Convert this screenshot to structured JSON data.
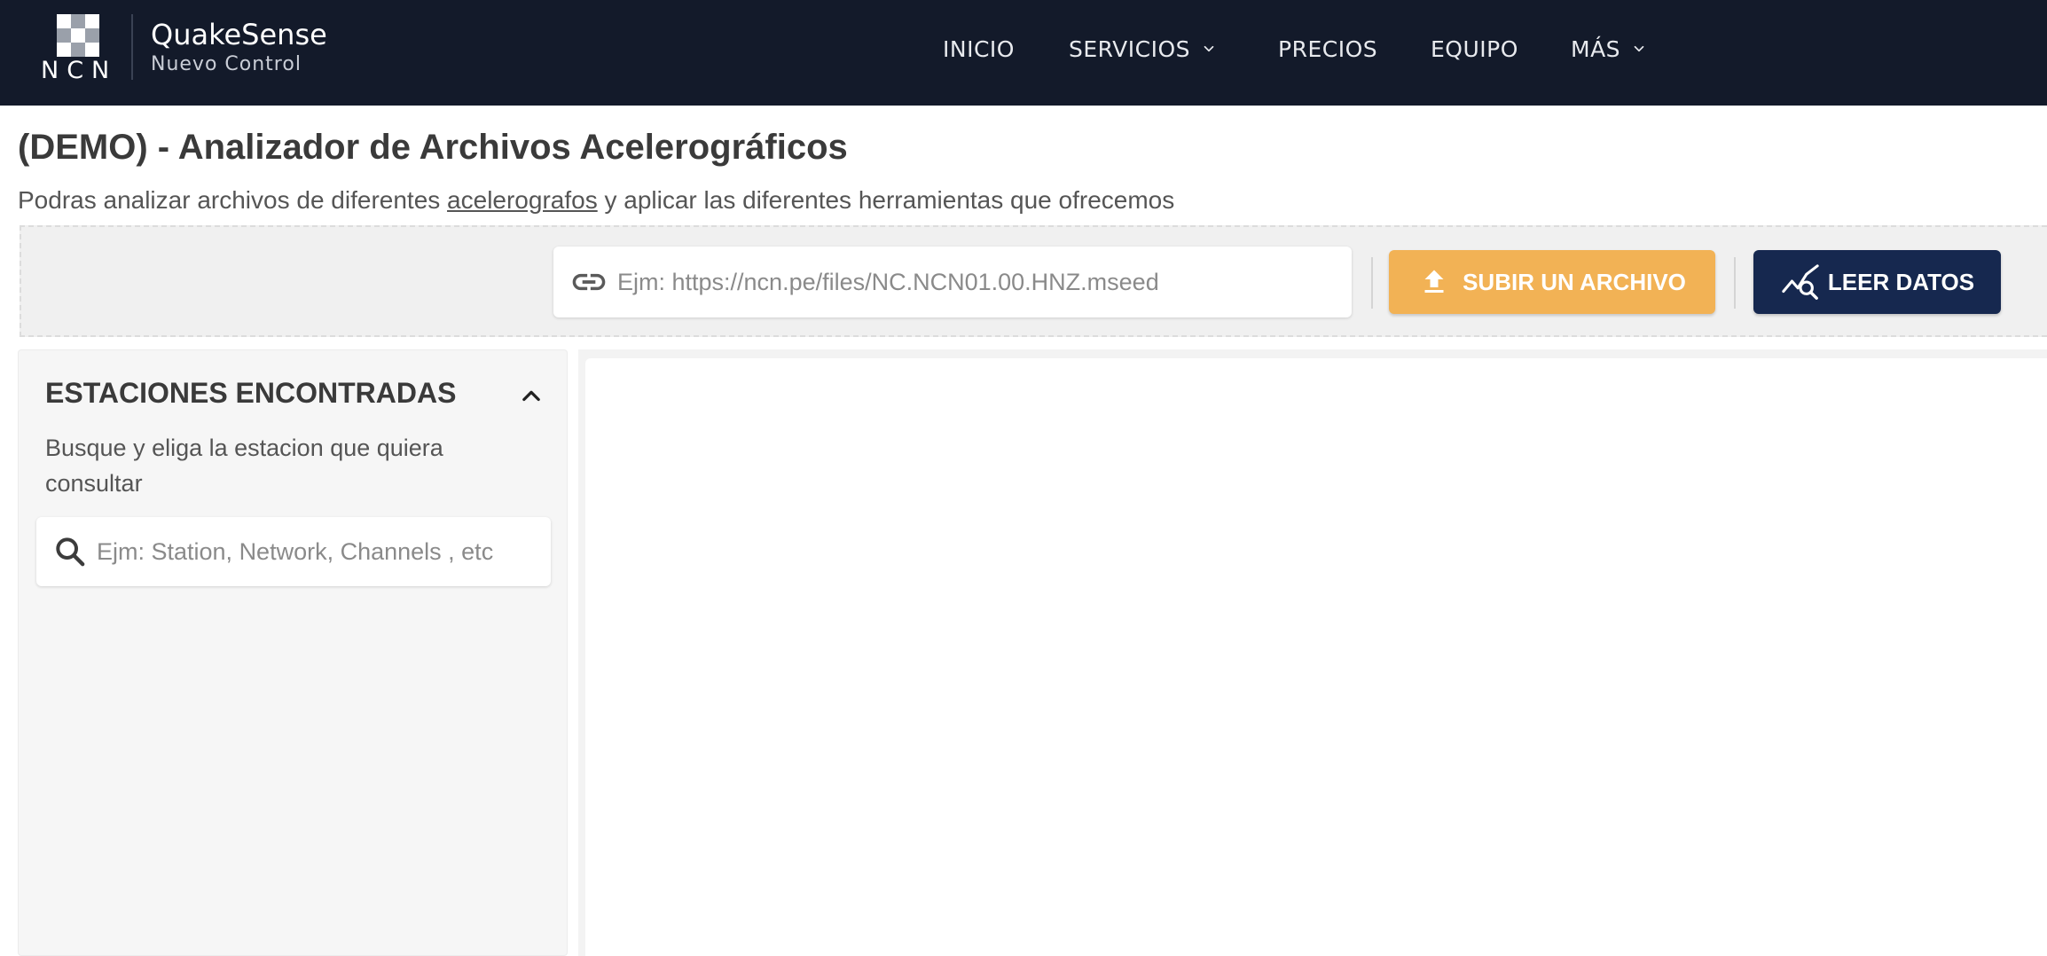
{
  "brand": {
    "logo_text": "NCN",
    "name": "QuakeSense",
    "tagline": "Nuevo Control"
  },
  "nav": {
    "items": [
      {
        "label": "INICIO",
        "has_dropdown": false
      },
      {
        "label": "SERVICIOS",
        "has_dropdown": true
      },
      {
        "label": "PRECIOS",
        "has_dropdown": false
      },
      {
        "label": "EQUIPO",
        "has_dropdown": false
      },
      {
        "label": "MÁS",
        "has_dropdown": true
      }
    ]
  },
  "header": {
    "title": "(DEMO) - Analizador de Archivos Acelerográficos",
    "subtitle_before": "Podras analizar archivos de diferentes ",
    "subtitle_link": "acelerografos",
    "subtitle_after": " y aplicar las diferentes herramientas que ofrecemos"
  },
  "toolbar": {
    "url_value": "",
    "url_placeholder": "Ejm: https://ncn.pe/files/NC.NCN01.00.HNZ.mseed",
    "upload_label": "SUBIR UN ARCHIVO",
    "read_label": "LEER DATOS"
  },
  "sidebar": {
    "title": "ESTACIONES ENCONTRADAS",
    "description": "Busque y eliga la estacion que quiera consultar",
    "search_value": "",
    "search_placeholder": "Ejm: Station, Network, Channels , etc",
    "collapsed": false
  },
  "colors": {
    "navbar_bg": "#131a2a",
    "upload_button": "#f2b255",
    "read_button": "#16284f",
    "panel_bg": "#f6f6f6"
  },
  "icons": {
    "url": "link-icon",
    "upload": "upload-icon",
    "read": "chart-search-icon",
    "search": "search-icon",
    "collapse": "chevron-up-icon",
    "dropdown": "chevron-down-icon"
  }
}
